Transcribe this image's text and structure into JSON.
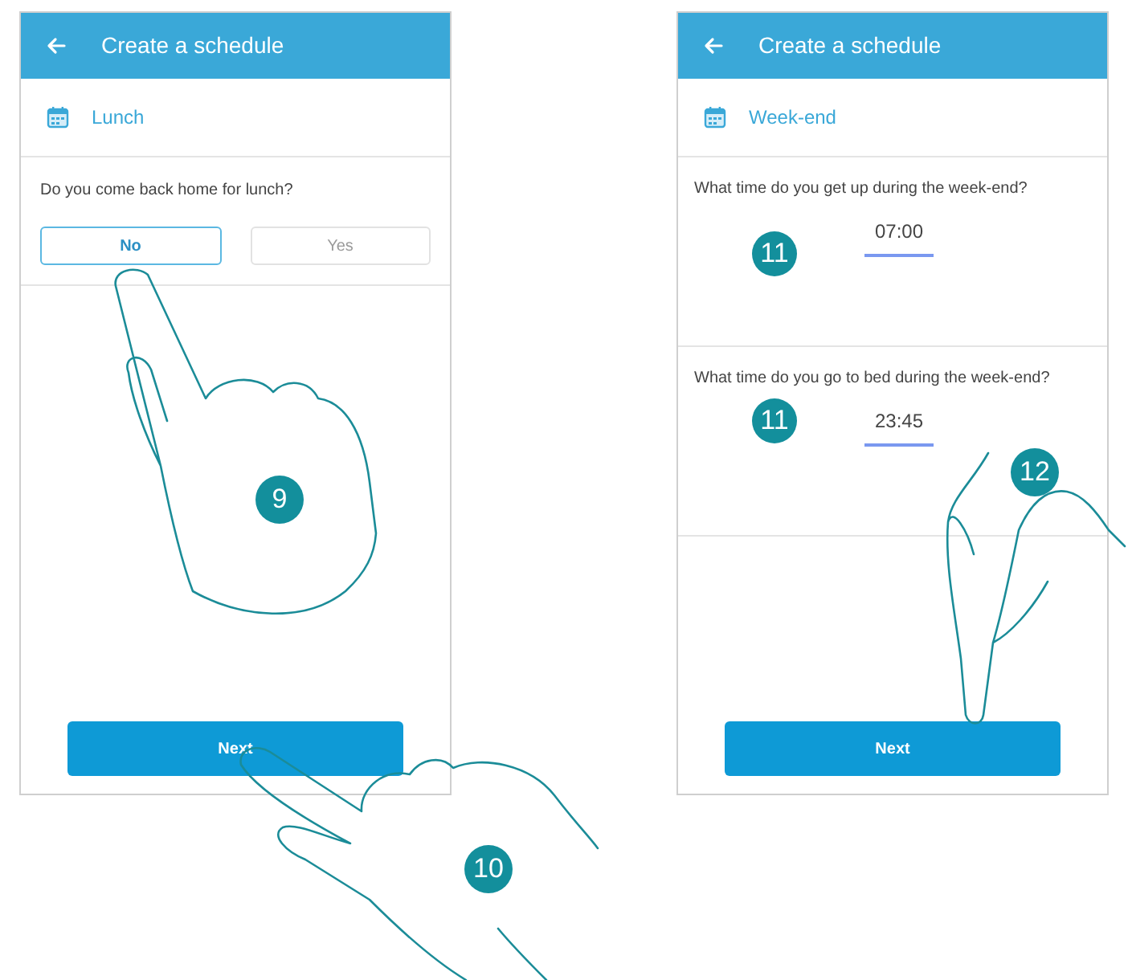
{
  "screens": [
    {
      "title": "Create a schedule",
      "section": "Lunch",
      "blocks": [
        {
          "kind": "choice",
          "question": "Do you come back home for lunch?",
          "options": [
            {
              "label": "No",
              "selected": true
            },
            {
              "label": "Yes",
              "selected": false
            }
          ]
        }
      ],
      "next_button": "Next"
    },
    {
      "title": "Create a schedule",
      "section": "Week-end",
      "blocks": [
        {
          "kind": "time",
          "question": "What time do you get up during the week-end?",
          "value": "07:00"
        },
        {
          "kind": "time",
          "question": "What time do you go to bed during the week-end?",
          "value": "23:45"
        }
      ],
      "next_button": "Next"
    }
  ],
  "step_badges": [
    {
      "label": "9"
    },
    {
      "label": "10"
    },
    {
      "label": "11"
    },
    {
      "label": "11"
    },
    {
      "label": "12"
    }
  ]
}
